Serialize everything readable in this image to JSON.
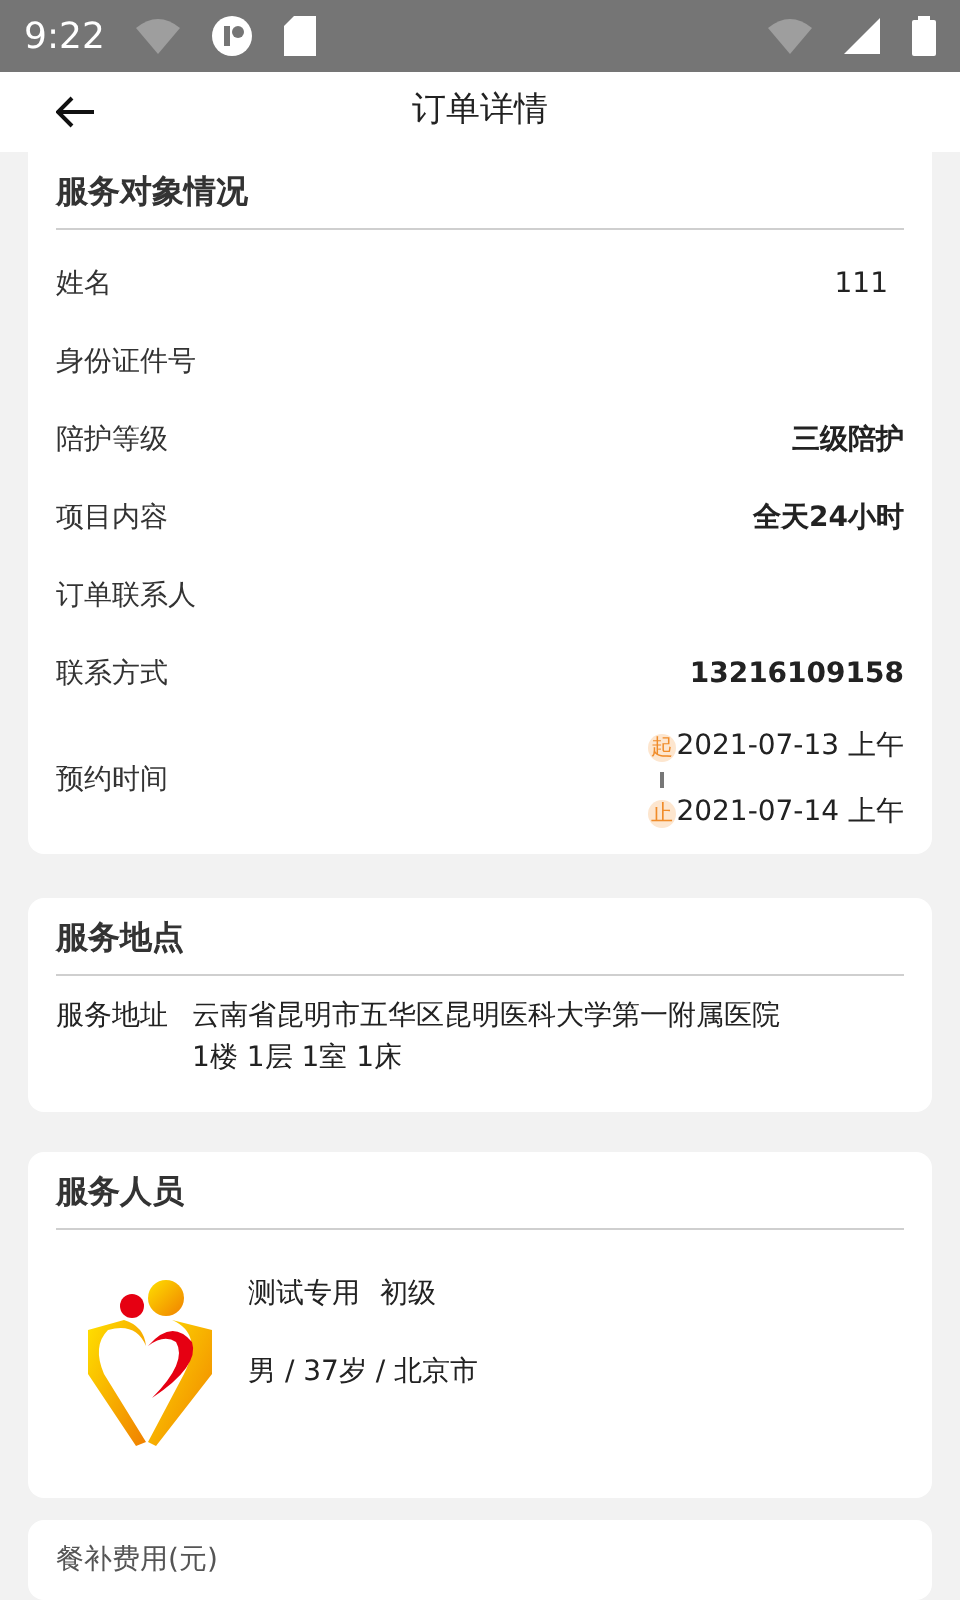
{
  "status_bar": {
    "time": "9:22"
  },
  "header": {
    "title": "订单详情"
  },
  "subject": {
    "title": "服务对象情况",
    "rows": [
      {
        "kind": "text",
        "label": "姓名",
        "value": "111",
        "emphasis": false
      },
      {
        "kind": "text",
        "label": "身份证件号"
      },
      {
        "kind": "text",
        "label": "陪护等级",
        "value": "三级陪护",
        "emphasis": true
      },
      {
        "kind": "text",
        "label": "项目内容",
        "value": "全天24小时",
        "emphasis": true
      },
      {
        "kind": "text",
        "label": "订单联系人"
      },
      {
        "kind": "text",
        "label": "联系方式",
        "value": "13216109158",
        "emphasis": true
      },
      {
        "kind": "range",
        "label": "预约时间",
        "start_tag": "起",
        "start": "2021-07-13 上午",
        "end_tag": "止",
        "end": "2021-07-14 上午"
      }
    ]
  },
  "location": {
    "title": "服务地点",
    "label": "服务地址",
    "address": "云南省昆明市五华区昆明医科大学第一附属医院",
    "detail": "1楼 1层 1室 1床"
  },
  "staff": {
    "title": "服务人员",
    "name": "测试专用",
    "level": "初级",
    "info": "男 / 37岁 / 北京市"
  },
  "fee": {
    "label": "餐补费用(元)"
  }
}
